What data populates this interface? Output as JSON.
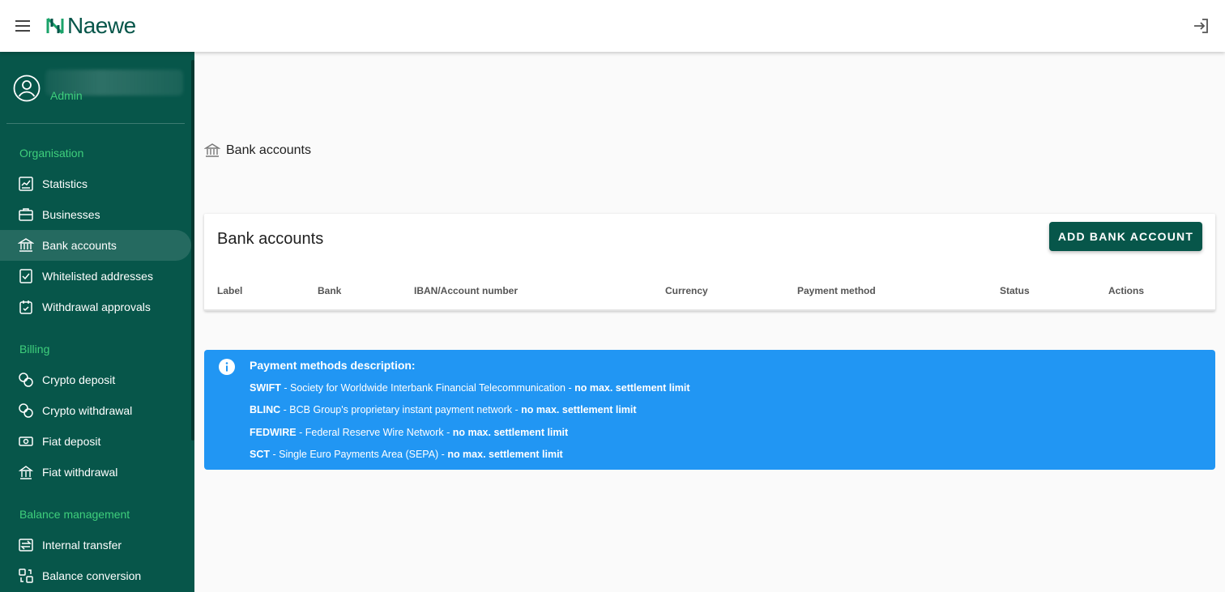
{
  "app": {
    "logo_text": "Naewe"
  },
  "user": {
    "role": "Admin"
  },
  "sidebar": {
    "sections": [
      {
        "title": "Organisation",
        "items": [
          {
            "label": "Statistics",
            "icon": "chart-icon"
          },
          {
            "label": "Businesses",
            "icon": "briefcase-icon"
          },
          {
            "label": "Bank accounts",
            "icon": "bank-icon",
            "active": true
          },
          {
            "label": "Whitelisted addresses",
            "icon": "checklist-icon"
          },
          {
            "label": "Withdrawal approvals",
            "icon": "approval-icon"
          }
        ]
      },
      {
        "title": "Billing",
        "items": [
          {
            "label": "Crypto deposit",
            "icon": "crypto-icon"
          },
          {
            "label": "Crypto withdrawal",
            "icon": "crypto-icon"
          },
          {
            "label": "Fiat deposit",
            "icon": "cash-icon"
          },
          {
            "label": "Fiat withdrawal",
            "icon": "cash-out-icon"
          }
        ]
      },
      {
        "title": "Balance management",
        "items": [
          {
            "label": "Internal transfer",
            "icon": "transfer-icon"
          },
          {
            "label": "Balance conversion",
            "icon": "conversion-icon"
          }
        ]
      }
    ]
  },
  "breadcrumb": {
    "label": "Bank accounts",
    "icon": "bank-icon"
  },
  "card": {
    "title": "Bank accounts",
    "add_button": "ADD BANK ACCOUNT",
    "columns": [
      "Label",
      "Bank",
      "IBAN/Account number",
      "Currency",
      "Payment method",
      "Status",
      "Actions"
    ]
  },
  "info": {
    "title": "Payment methods description:",
    "lines": [
      {
        "code": "SWIFT",
        "desc": " - Society for Worldwide Interbank Financial Telecommunication - ",
        "limit": "no max. settlement limit"
      },
      {
        "code": "BLINC",
        "desc": " - BCB Group's proprietary instant payment network - ",
        "limit": "no max. settlement limit"
      },
      {
        "code": "FEDWIRE",
        "desc": " - Federal Reserve Wire Network - ",
        "limit": "no max. settlement limit"
      },
      {
        "code": "SCT",
        "desc": " - Single Euro Payments Area (SEPA) - ",
        "limit": "no max. settlement limit"
      }
    ]
  },
  "colors": {
    "brand": "#07564a",
    "accent_green": "#3fcf7c",
    "info_blue": "#2196f3"
  }
}
